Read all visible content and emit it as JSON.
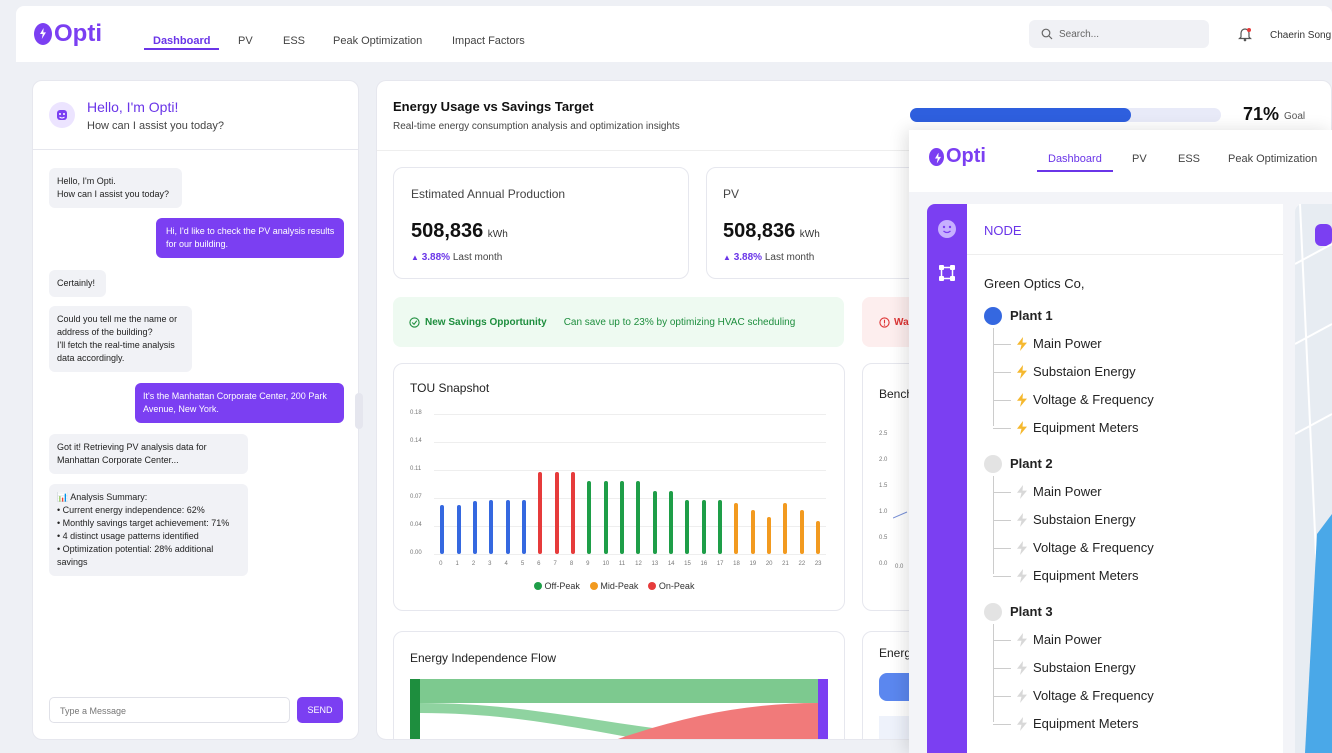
{
  "app": {
    "logo": "Opti",
    "user": "Chaerin Song"
  },
  "nav": {
    "tabs": [
      "Dashboard",
      "PV",
      "ESS",
      "Peak Optimization",
      "Impact Factors"
    ],
    "active": "Dashboard"
  },
  "search": {
    "placeholder": "Search..."
  },
  "chat": {
    "title": "Hello, I'm Opti!",
    "subtitle": "How can I assist you today?",
    "messages": [
      {
        "from": "bot",
        "text": "Hello, I'm Opti.\nHow can I assist you today?"
      },
      {
        "from": "user",
        "text": "Hi, I'd like to check the PV analysis results for our building."
      },
      {
        "from": "bot",
        "text": "Certainly!"
      },
      {
        "from": "bot",
        "text": "Could you tell me the name or address of the building?\nI'll fetch the real-time analysis data accordingly."
      },
      {
        "from": "user",
        "text": "It's the Manhattan Corporate Center, 200 Park Avenue, New York."
      },
      {
        "from": "bot",
        "text": "Got it! Retrieving PV analysis data for Manhattan Corporate Center..."
      },
      {
        "from": "bot",
        "text": "📊 Analysis Summary:\n• Current energy independence: 62%\n• Monthly savings target achievement: 71%\n• 4 distinct usage patterns identified\n• Optimization potential: 28% additional savings"
      }
    ],
    "input_placeholder": "Type a Message",
    "send_label": "SEND"
  },
  "main": {
    "title": "Energy Usage vs Savings Target",
    "subtitle": "Real-time energy consumption analysis and optimization insights",
    "progress": {
      "value": 0.71,
      "percent_label": "71%",
      "goal_label": "Goal"
    },
    "kpis": [
      {
        "label": "Estimated Annual Production",
        "value": "508,836",
        "unit": "kWh",
        "delta": "3.88%",
        "delta_note": "Last month"
      },
      {
        "label": "PV",
        "value": "508,836",
        "unit": "kWh",
        "delta": "3.88%",
        "delta_note": "Last month"
      }
    ],
    "alert": {
      "title": "New Savings Opportunity",
      "text": "Can save up to 23% by optimizing HVAC scheduling"
    },
    "alert2": {
      "title": "Wa"
    },
    "tou_title": "TOU Snapshot",
    "bench_title": "Bench",
    "flow_title": "Energy Independence Flow",
    "energy_title": "Energ",
    "bench_ticks": [
      "2.5",
      "2.0",
      "1.5",
      "1.0",
      "0.5",
      "0.0"
    ],
    "bench_x0": "0.0"
  },
  "chart_data": {
    "type": "bar",
    "title": "TOU Snapshot",
    "categories": [
      "0",
      "1",
      "2",
      "3",
      "4",
      "5",
      "6",
      "7",
      "8",
      "9",
      "10",
      "11",
      "12",
      "13",
      "14",
      "15",
      "16",
      "17",
      "18",
      "19",
      "20",
      "21",
      "22",
      "23"
    ],
    "values": [
      0.063,
      0.063,
      0.068,
      0.07,
      0.07,
      0.07,
      0.105,
      0.105,
      0.105,
      0.094,
      0.094,
      0.094,
      0.094,
      0.081,
      0.081,
      0.07,
      0.07,
      0.07,
      0.065,
      0.056,
      0.047,
      0.065,
      0.056,
      0.043
    ],
    "period": [
      "Off-Peak",
      "Off-Peak",
      "Off-Peak",
      "Off-Peak",
      "Off-Peak",
      "Off-Peak",
      "On-Peak",
      "On-Peak",
      "On-Peak",
      "Off-Peak",
      "Off-Peak",
      "Off-Peak",
      "Off-Peak",
      "Off-Peak",
      "Off-Peak",
      "Off-Peak",
      "Off-Peak",
      "Off-Peak",
      "Mid-Peak",
      "Mid-Peak",
      "Mid-Peak",
      "Mid-Peak",
      "Mid-Peak",
      "Mid-Peak"
    ],
    "yticks": [
      "0.18",
      "0.14",
      "0.11",
      "0.07",
      "0.04",
      "0.00"
    ],
    "ylim": [
      0,
      0.18
    ],
    "legend": [
      {
        "name": "Off-Peak",
        "color": "#1e9e48"
      },
      {
        "name": "Mid-Peak",
        "color": "#f29a1f"
      },
      {
        "name": "On-Peak",
        "color": "#e63b3b"
      }
    ],
    "colors_note": {
      "first_bars": "#3568e0"
    }
  },
  "overlay": {
    "logo": "Opti",
    "tabs": [
      "Dashboard",
      "PV",
      "ESS",
      "Peak Optimization"
    ],
    "node_title": "NODE",
    "company": "Green Optics Co,",
    "plants": [
      {
        "name": "Plant 1",
        "active": true,
        "items": [
          "Main Power",
          "Substaion Energy",
          "Voltage & Frequency",
          "Equipment Meters"
        ]
      },
      {
        "name": "Plant 2",
        "active": false,
        "items": [
          "Main Power",
          "Substaion Energy",
          "Voltage & Frequency",
          "Equipment Meters"
        ]
      },
      {
        "name": "Plant 3",
        "active": false,
        "items": [
          "Main Power",
          "Substaion Energy",
          "Voltage & Frequency",
          "Equipment Meters"
        ]
      }
    ]
  },
  "colors": {
    "accent": "#7b3ff2",
    "blue": "#3568e0",
    "green": "#1e9e48",
    "orange": "#f29a1f",
    "red": "#e63b3b"
  }
}
